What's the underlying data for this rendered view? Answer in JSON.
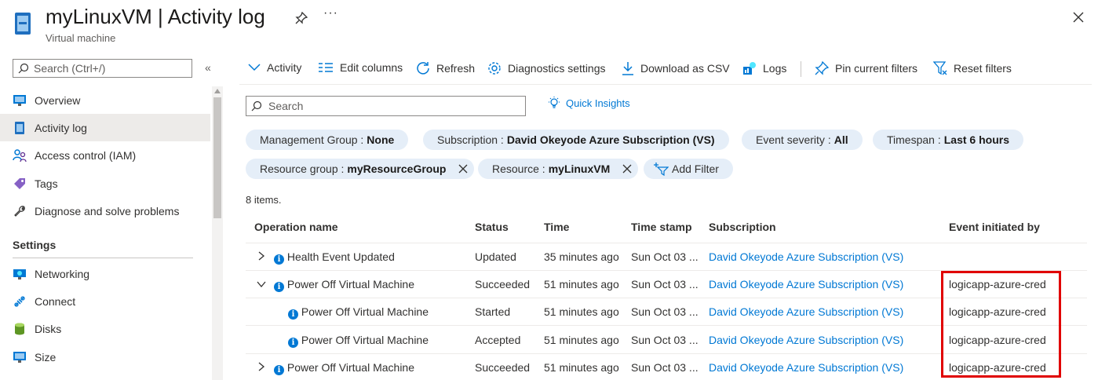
{
  "header": {
    "title": "myLinuxVM | Activity log",
    "subtitle": "Virtual machine",
    "more": "···"
  },
  "sidebar": {
    "search_placeholder": "Search (Ctrl+/)",
    "collapse": "«",
    "items": [
      {
        "label": "Overview",
        "icon": "monitor-icon"
      },
      {
        "label": "Activity log",
        "icon": "activity-log-icon",
        "selected": true
      },
      {
        "label": "Access control (IAM)",
        "icon": "people-icon"
      },
      {
        "label": "Tags",
        "icon": "tag-icon"
      },
      {
        "label": "Diagnose and solve problems",
        "icon": "wrench-icon"
      }
    ],
    "section": "Settings",
    "settings_items": [
      {
        "label": "Networking",
        "icon": "networking-icon"
      },
      {
        "label": "Connect",
        "icon": "connect-icon"
      },
      {
        "label": "Disks",
        "icon": "disks-icon"
      },
      {
        "label": "Size",
        "icon": "size-icon"
      }
    ]
  },
  "toolbar": {
    "activity": "Activity",
    "edit_columns": "Edit columns",
    "refresh": "Refresh",
    "diagnostics": "Diagnostics settings",
    "download": "Download as CSV",
    "logs": "Logs",
    "pin_filters": "Pin current filters",
    "reset_filters": "Reset filters"
  },
  "search": {
    "placeholder": "Search"
  },
  "quick_insights": "Quick Insights",
  "filters": {
    "mgmt_group": {
      "key": "Management Group :",
      "value": "None"
    },
    "subscription": {
      "key": "Subscription :",
      "value": "David Okeyode Azure Subscription (VS)"
    },
    "severity": {
      "key": "Event severity :",
      "value": "All"
    },
    "timespan": {
      "key": "Timespan :",
      "value": "Last 6 hours"
    },
    "resource_group": {
      "key": "Resource group :",
      "value": "myResourceGroup"
    },
    "resource": {
      "key": "Resource :",
      "value": "myLinuxVM"
    },
    "add_filter": "Add Filter"
  },
  "item_count": "8 items.",
  "table": {
    "columns": [
      "Operation name",
      "Status",
      "Time",
      "Time stamp",
      "Subscription",
      "Event initiated by"
    ],
    "rows": [
      {
        "operation": "Health Event Updated",
        "status": "Updated",
        "time": "35 minutes ago",
        "timestamp": "Sun Oct 03 ...",
        "subscription": "David Okeyode Azure Subscription (VS)",
        "initiated_by": "",
        "expander": "collapsed"
      },
      {
        "operation": "Power Off Virtual Machine",
        "status": "Succeeded",
        "time": "51 minutes ago",
        "timestamp": "Sun Oct 03 ...",
        "subscription": "David Okeyode Azure Subscription (VS)",
        "initiated_by": "logicapp-azure-cred",
        "expander": "expanded"
      },
      {
        "operation": "Power Off Virtual Machine",
        "status": "Started",
        "time": "51 minutes ago",
        "timestamp": "Sun Oct 03 ...",
        "subscription": "David Okeyode Azure Subscription (VS)",
        "initiated_by": "logicapp-azure-cred",
        "expander": "child"
      },
      {
        "operation": "Power Off Virtual Machine",
        "status": "Accepted",
        "time": "51 minutes ago",
        "timestamp": "Sun Oct 03 ...",
        "subscription": "David Okeyode Azure Subscription (VS)",
        "initiated_by": "logicapp-azure-cred",
        "expander": "child"
      },
      {
        "operation": "Power Off Virtual Machine",
        "status": "Succeeded",
        "time": "51 minutes ago",
        "timestamp": "Sun Oct 03 ...",
        "subscription": "David Okeyode Azure Subscription (VS)",
        "initiated_by": "logicapp-azure-cred",
        "expander": "collapsed"
      }
    ]
  },
  "colors": {
    "accent": "#0078d4",
    "highlight_box": "#e00000",
    "pill_bg": "#e5eef8",
    "selected_bg": "#edebe9"
  }
}
